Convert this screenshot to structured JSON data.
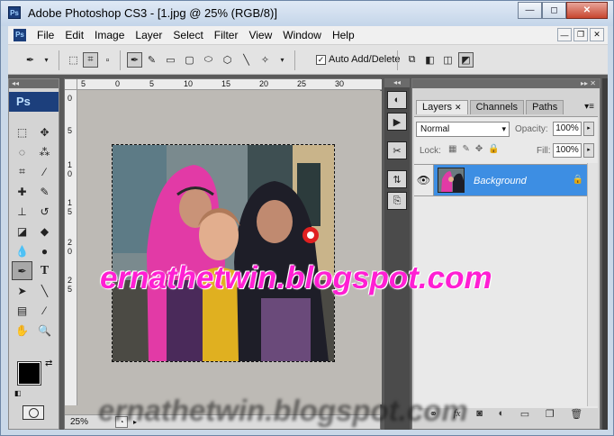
{
  "window": {
    "title": "Adobe Photoshop CS3 - [1.jpg @ 25% (RGB/8)]",
    "app_badge": "Ps",
    "buttons": {
      "minimize": "—",
      "restore": "◻",
      "close": "✕"
    }
  },
  "menubar": {
    "items": [
      "File",
      "Edit",
      "Image",
      "Layer",
      "Select",
      "Filter",
      "View",
      "Window",
      "Help"
    ],
    "doc_buttons": {
      "minimize": "—",
      "restore": "❐",
      "close": "✕"
    }
  },
  "options_bar": {
    "auto_add_delete_label": "Auto Add/Delete",
    "auto_add_delete_checked": true
  },
  "toolbox": {
    "logo": "Ps",
    "foreground_color": "#000000",
    "background_color": "#ffffff"
  },
  "document": {
    "zoom": "25%",
    "ruler_top_ticks": [
      "5",
      "0",
      "5",
      "10",
      "15",
      "20",
      "25",
      "30"
    ],
    "ruler_left_ticks": [
      "0",
      "5",
      "1",
      "0",
      "1",
      "5",
      "2",
      "0",
      "2",
      "5"
    ],
    "watermark_text": "ernathetwin.blogspot.com",
    "watermark_shadow_text": "ernathetwin.blogspot.com",
    "watermark_color": "#ff1fd3"
  },
  "layers_panel": {
    "tabs": [
      "Layers",
      "Channels",
      "Paths"
    ],
    "active_tab": "Layers",
    "blend_mode": "Normal",
    "opacity_label": "Opacity:",
    "opacity_value": "100%",
    "lock_label": "Lock:",
    "fill_label": "Fill:",
    "fill_value": "100%",
    "layers": [
      {
        "name": "Background",
        "visible": true,
        "locked": true
      }
    ],
    "selection_color": "#3d8ee3"
  }
}
